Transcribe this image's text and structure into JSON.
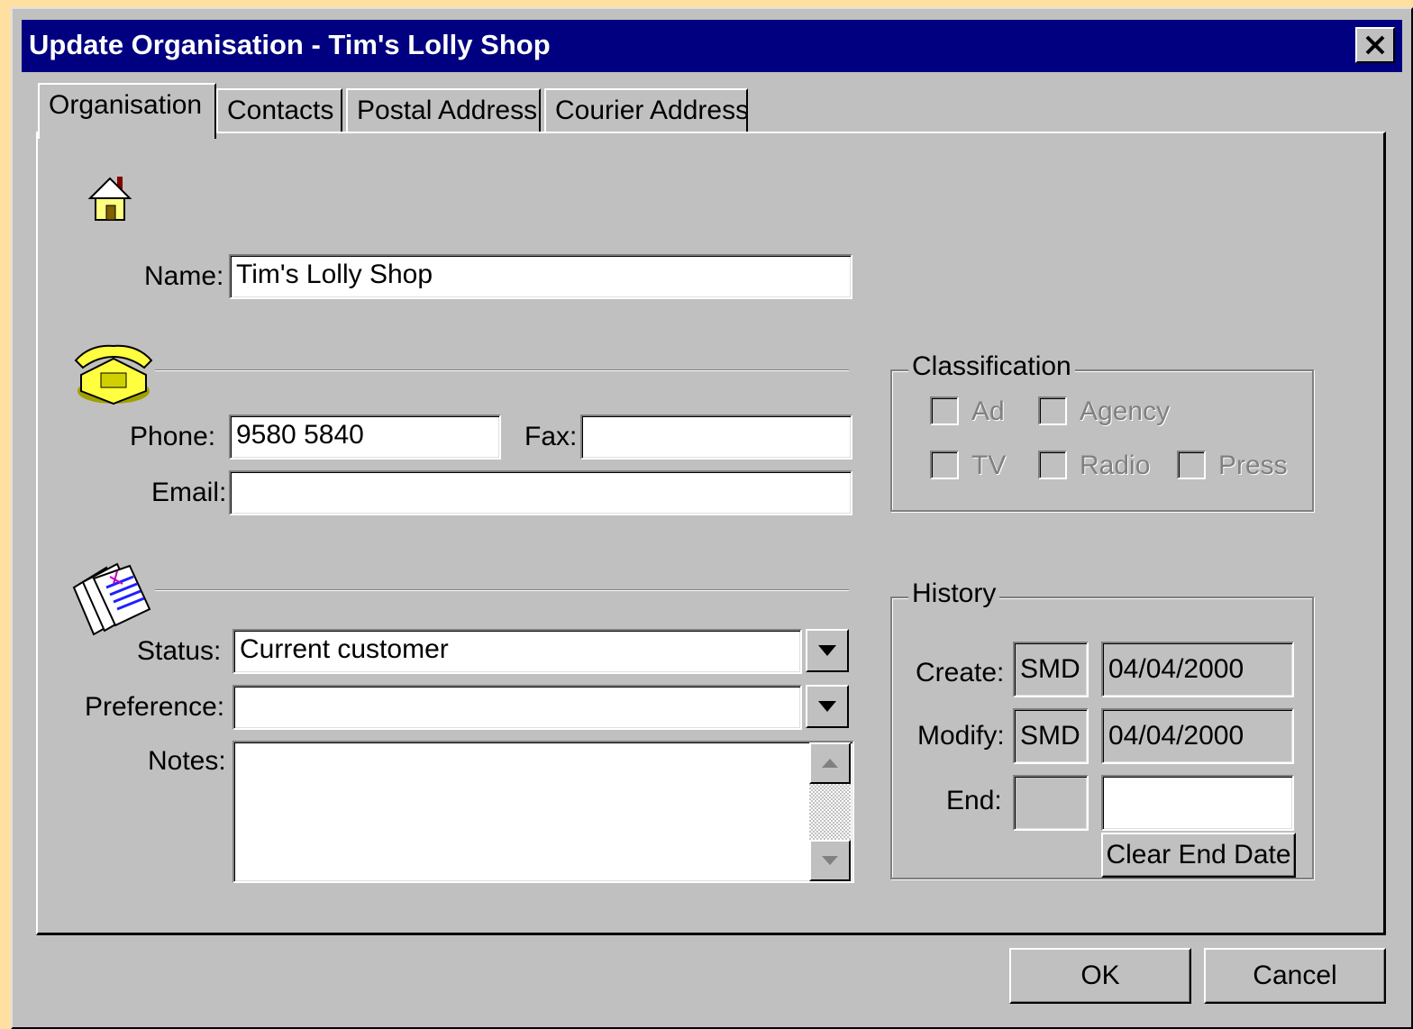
{
  "window": {
    "title": "Update Organisation - Tim's Lolly Shop"
  },
  "tabs": [
    {
      "label": "Organisation",
      "active": true
    },
    {
      "label": "Contacts",
      "active": false
    },
    {
      "label": "Postal Address",
      "active": false
    },
    {
      "label": "Courier Address",
      "active": false
    }
  ],
  "icons": {
    "organisation": "house-icon",
    "contact": "telephone-icon",
    "notes": "notes-icon",
    "close": "close-icon",
    "dropdown": "chevron-down-icon"
  },
  "form": {
    "name_label": "Name:",
    "name_value": "Tim's Lolly Shop",
    "phone_label": "Phone:",
    "phone_value": "9580 5840",
    "fax_label": "Fax:",
    "fax_value": "",
    "email_label": "Email:",
    "email_value": "",
    "status_label": "Status:",
    "status_value": "Current customer",
    "preference_label": "Preference:",
    "preference_value": "",
    "notes_label": "Notes:",
    "notes_value": ""
  },
  "classification": {
    "title": "Classification",
    "options": [
      {
        "label": "Ad",
        "checked": false,
        "enabled": false
      },
      {
        "label": "Agency",
        "checked": false,
        "enabled": false
      },
      {
        "label": "TV",
        "checked": false,
        "enabled": false
      },
      {
        "label": "Radio",
        "checked": false,
        "enabled": false
      },
      {
        "label": "Press",
        "checked": false,
        "enabled": false
      }
    ]
  },
  "history": {
    "title": "History",
    "create_label": "Create:",
    "create_user": "SMD",
    "create_date": "04/04/2000",
    "modify_label": "Modify:",
    "modify_user": "SMD",
    "modify_date": "04/04/2000",
    "end_label": "End:",
    "end_user": "",
    "end_date": "",
    "clear_button": "Clear End Date"
  },
  "buttons": {
    "ok": "OK",
    "cancel": "Cancel"
  },
  "colors": {
    "titlebar": "#000080",
    "face": "#c0c0c0",
    "outer_background": "#ffe0a0"
  }
}
